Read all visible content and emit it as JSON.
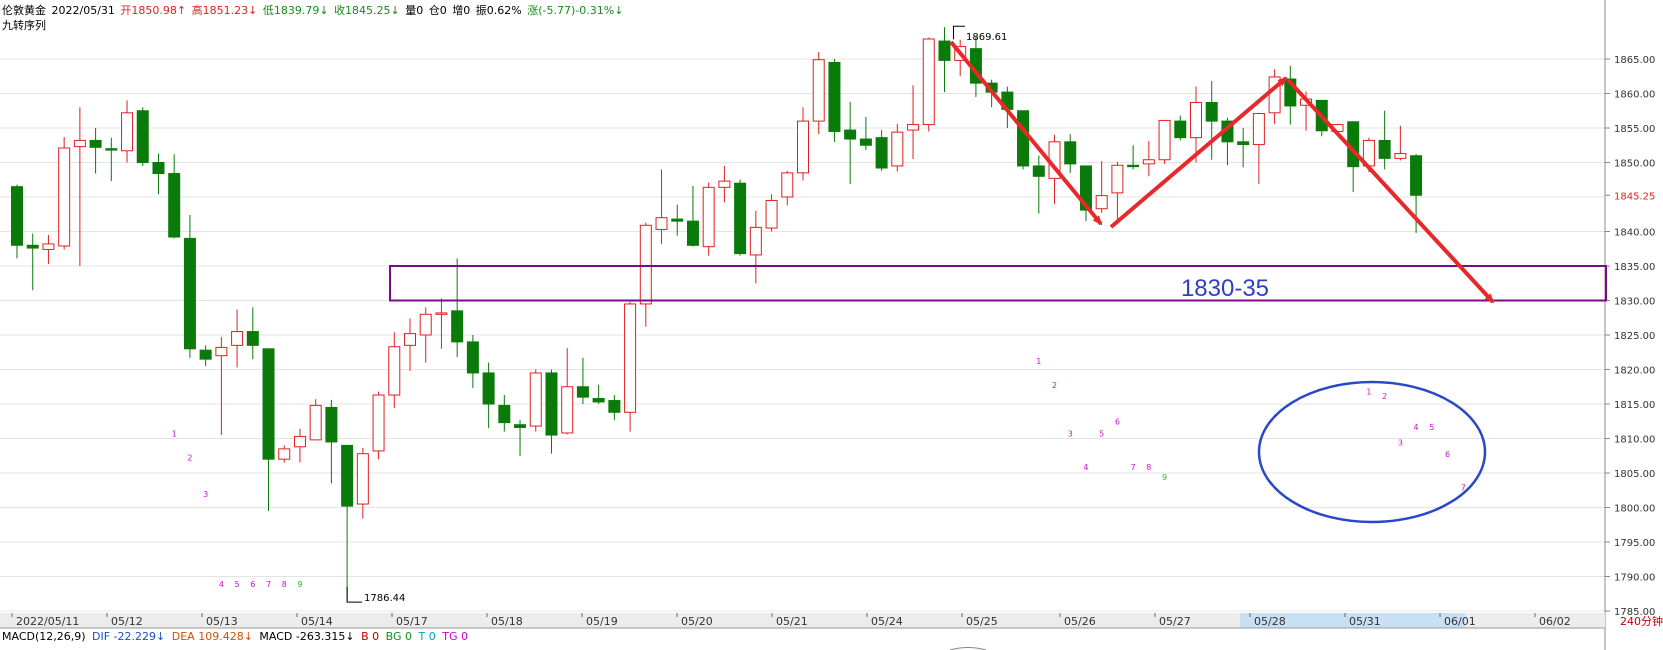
{
  "header": {
    "instrument": "伦敦黄金",
    "date": "2022/05/31",
    "open": "开1850.98↑",
    "high": "高1851.23↓",
    "low": "低1839.79↓",
    "close": "收1845.25↓",
    "volume": "量0",
    "position": "仓0",
    "increase": "增0",
    "amplitude": "振0.62%",
    "change": "涨(-5.77)-0.31%↓"
  },
  "indicator_name": "九转序列",
  "price_axis": {
    "labels": [
      "1865.00",
      "1860.00",
      "1855.00",
      "1850.00",
      "1845.25",
      "1840.00",
      "1835.00",
      "1830.00",
      "1825.00",
      "1820.00",
      "1815.00",
      "1810.00",
      "1805.00",
      "1800.00",
      "1795.00",
      "1790.00",
      "1785.00"
    ],
    "current_price": "1845.25",
    "current_color": "#e02020"
  },
  "date_axis": {
    "labels": [
      "2022/05/11",
      "05/12",
      "05/13",
      "05/14",
      "05/17",
      "05/18",
      "05/19",
      "05/20",
      "05/21",
      "05/24",
      "05/25",
      "05/26",
      "05/27",
      "05/28",
      "05/31",
      "06/01",
      "06/02"
    ],
    "period": "240分钟"
  },
  "annotations": {
    "high_label": "1869.61",
    "low_label": "1786.44",
    "zone_label": "1830-35"
  },
  "macd": {
    "name": "MACD(12,26,9)",
    "dif": "DIF -22.229↓",
    "dea": "DEA 109.428↓",
    "macd": "MACD -263.315↓",
    "b": "B 0",
    "bg": "BG 0",
    "t": "T 0",
    "tg": "TG 0"
  },
  "colors": {
    "up": "#e02020",
    "down": "#0a7a0a",
    "zone": "#7a0a8a",
    "circle": "#2848c8",
    "arrow": "#e8282a",
    "seq": "#d010d0",
    "seq9": "#20c020"
  },
  "chart_data": {
    "type": "candlestick",
    "y_axis_range": [
      1785,
      1865
    ],
    "candles": [
      {
        "o": 1846.5,
        "h": 1846.8,
        "l": 1836.1,
        "c": 1838.0
      },
      {
        "o": 1838.0,
        "h": 1839.7,
        "l": 1831.5,
        "c": 1837.6
      },
      {
        "o": 1837.4,
        "h": 1839.5,
        "l": 1835.3,
        "c": 1838.2
      },
      {
        "o": 1837.9,
        "h": 1853.7,
        "l": 1837.4,
        "c": 1852.1
      },
      {
        "o": 1852.3,
        "h": 1858.0,
        "l": 1835.0,
        "c": 1853.2
      },
      {
        "o": 1853.2,
        "h": 1855.0,
        "l": 1848.4,
        "c": 1852.2
      },
      {
        "o": 1852.0,
        "h": 1853.6,
        "l": 1847.3,
        "c": 1851.8
      },
      {
        "o": 1851.7,
        "h": 1859.0,
        "l": 1850.0,
        "c": 1857.2
      },
      {
        "o": 1857.5,
        "h": 1858.0,
        "l": 1849.5,
        "c": 1850.0
      },
      {
        "o": 1850.0,
        "h": 1851.3,
        "l": 1845.4,
        "c": 1848.4
      },
      {
        "o": 1848.4,
        "h": 1851.2,
        "l": 1839.0,
        "c": 1839.2
      },
      {
        "o": 1839.0,
        "h": 1842.4,
        "l": 1821.7,
        "c": 1823.0
      },
      {
        "o": 1822.8,
        "h": 1823.5,
        "l": 1820.5,
        "c": 1821.5
      },
      {
        "o": 1822.0,
        "h": 1824.7,
        "l": 1810.5,
        "c": 1823.2
      },
      {
        "o": 1823.5,
        "h": 1828.7,
        "l": 1820.3,
        "c": 1825.5
      },
      {
        "o": 1825.5,
        "h": 1829.0,
        "l": 1821.5,
        "c": 1823.5
      },
      {
        "o": 1823.0,
        "h": 1823.0,
        "l": 1799.5,
        "c": 1807.0
      },
      {
        "o": 1807.0,
        "h": 1809.0,
        "l": 1806.5,
        "c": 1808.5
      },
      {
        "o": 1808.8,
        "h": 1811.4,
        "l": 1806.5,
        "c": 1810.3
      },
      {
        "o": 1809.8,
        "h": 1815.7,
        "l": 1809.8,
        "c": 1814.8
      },
      {
        "o": 1814.5,
        "h": 1815.6,
        "l": 1803.5,
        "c": 1809.5
      },
      {
        "o": 1809.0,
        "h": 1809.0,
        "l": 1786.44,
        "c": 1800.2
      },
      {
        "o": 1800.5,
        "h": 1808.6,
        "l": 1798.4,
        "c": 1807.8
      },
      {
        "o": 1808.2,
        "h": 1816.8,
        "l": 1807.0,
        "c": 1816.3
      },
      {
        "o": 1816.3,
        "h": 1825.4,
        "l": 1814.4,
        "c": 1823.3
      },
      {
        "o": 1823.5,
        "h": 1827.4,
        "l": 1819.8,
        "c": 1825.2
      },
      {
        "o": 1825.0,
        "h": 1829.0,
        "l": 1821.0,
        "c": 1828.0
      },
      {
        "o": 1828.0,
        "h": 1830.3,
        "l": 1823.0,
        "c": 1828.2
      },
      {
        "o": 1828.5,
        "h": 1836.1,
        "l": 1821.8,
        "c": 1824.0
      },
      {
        "o": 1824.0,
        "h": 1825.0,
        "l": 1817.3,
        "c": 1819.5
      },
      {
        "o": 1819.5,
        "h": 1821.0,
        "l": 1811.5,
        "c": 1815.0
      },
      {
        "o": 1814.8,
        "h": 1816.3,
        "l": 1811.0,
        "c": 1812.3
      },
      {
        "o": 1812.0,
        "h": 1812.7,
        "l": 1807.5,
        "c": 1811.6
      },
      {
        "o": 1811.8,
        "h": 1820.0,
        "l": 1811.0,
        "c": 1819.5
      },
      {
        "o": 1819.5,
        "h": 1820.0,
        "l": 1807.8,
        "c": 1810.5
      },
      {
        "o": 1810.8,
        "h": 1823.1,
        "l": 1810.6,
        "c": 1817.5
      },
      {
        "o": 1817.5,
        "h": 1821.7,
        "l": 1815.0,
        "c": 1816.0
      },
      {
        "o": 1815.8,
        "h": 1817.8,
        "l": 1815.0,
        "c": 1815.3
      },
      {
        "o": 1815.5,
        "h": 1816.3,
        "l": 1812.7,
        "c": 1813.8
      },
      {
        "o": 1813.8,
        "h": 1829.8,
        "l": 1811.0,
        "c": 1829.5
      },
      {
        "o": 1829.5,
        "h": 1841.3,
        "l": 1826.2,
        "c": 1840.9
      },
      {
        "o": 1840.3,
        "h": 1849.0,
        "l": 1838.2,
        "c": 1842.0
      },
      {
        "o": 1841.8,
        "h": 1843.9,
        "l": 1839.4,
        "c": 1841.5
      },
      {
        "o": 1841.5,
        "h": 1846.6,
        "l": 1837.8,
        "c": 1838.0
      },
      {
        "o": 1837.8,
        "h": 1847.1,
        "l": 1836.5,
        "c": 1846.4
      },
      {
        "o": 1846.4,
        "h": 1849.5,
        "l": 1844.2,
        "c": 1847.3
      },
      {
        "o": 1847.0,
        "h": 1847.5,
        "l": 1836.5,
        "c": 1836.8
      },
      {
        "o": 1836.6,
        "h": 1843.0,
        "l": 1832.5,
        "c": 1840.6
      },
      {
        "o": 1840.5,
        "h": 1845.4,
        "l": 1840.0,
        "c": 1844.5
      },
      {
        "o": 1845.0,
        "h": 1848.8,
        "l": 1843.8,
        "c": 1848.5
      },
      {
        "o": 1848.5,
        "h": 1858.0,
        "l": 1847.4,
        "c": 1856.0
      },
      {
        "o": 1856.0,
        "h": 1866.0,
        "l": 1854.1,
        "c": 1864.9
      },
      {
        "o": 1864.5,
        "h": 1865.0,
        "l": 1853.0,
        "c": 1854.5
      },
      {
        "o": 1854.7,
        "h": 1858.8,
        "l": 1846.9,
        "c": 1853.4
      },
      {
        "o": 1853.4,
        "h": 1856.6,
        "l": 1851.8,
        "c": 1852.5
      },
      {
        "o": 1853.6,
        "h": 1854.7,
        "l": 1848.8,
        "c": 1849.2
      },
      {
        "o": 1849.5,
        "h": 1855.6,
        "l": 1848.7,
        "c": 1854.4
      },
      {
        "o": 1854.7,
        "h": 1861.2,
        "l": 1850.5,
        "c": 1855.5
      },
      {
        "o": 1855.5,
        "h": 1868.1,
        "l": 1854.5,
        "c": 1867.9
      },
      {
        "o": 1867.6,
        "h": 1869.61,
        "l": 1860.2,
        "c": 1864.8
      },
      {
        "o": 1864.8,
        "h": 1867.8,
        "l": 1862.5,
        "c": 1866.8
      },
      {
        "o": 1866.5,
        "h": 1868.3,
        "l": 1859.5,
        "c": 1861.5
      },
      {
        "o": 1861.5,
        "h": 1862.0,
        "l": 1858.0,
        "c": 1860.2
      },
      {
        "o": 1860.2,
        "h": 1861.0,
        "l": 1855.0,
        "c": 1857.7
      },
      {
        "o": 1857.5,
        "h": 1857.5,
        "l": 1849.0,
        "c": 1849.5
      },
      {
        "o": 1849.5,
        "h": 1851.0,
        "l": 1842.6,
        "c": 1848.0
      },
      {
        "o": 1847.7,
        "h": 1854.0,
        "l": 1844.0,
        "c": 1853.0
      },
      {
        "o": 1853.0,
        "h": 1854.1,
        "l": 1848.5,
        "c": 1849.8
      },
      {
        "o": 1849.5,
        "h": 1849.5,
        "l": 1841.5,
        "c": 1843.1
      },
      {
        "o": 1843.3,
        "h": 1850.2,
        "l": 1842.7,
        "c": 1845.2
      },
      {
        "o": 1845.6,
        "h": 1850.1,
        "l": 1841.2,
        "c": 1849.6
      },
      {
        "o": 1849.6,
        "h": 1852.5,
        "l": 1849.0,
        "c": 1849.4
      },
      {
        "o": 1849.8,
        "h": 1853.1,
        "l": 1848.0,
        "c": 1850.4
      },
      {
        "o": 1850.4,
        "h": 1856.1,
        "l": 1849.8,
        "c": 1856.1
      },
      {
        "o": 1856.0,
        "h": 1856.8,
        "l": 1853.2,
        "c": 1853.6
      },
      {
        "o": 1853.6,
        "h": 1861.0,
        "l": 1850.0,
        "c": 1858.7
      },
      {
        "o": 1858.7,
        "h": 1861.8,
        "l": 1850.4,
        "c": 1856.0
      },
      {
        "o": 1856.0,
        "h": 1856.5,
        "l": 1849.6,
        "c": 1853.0
      },
      {
        "o": 1853.0,
        "h": 1855.0,
        "l": 1849.3,
        "c": 1852.6
      },
      {
        "o": 1852.6,
        "h": 1857.2,
        "l": 1846.9,
        "c": 1857.1
      },
      {
        "o": 1857.2,
        "h": 1863.5,
        "l": 1855.6,
        "c": 1862.4
      },
      {
        "o": 1862.1,
        "h": 1864.0,
        "l": 1855.5,
        "c": 1858.2
      },
      {
        "o": 1858.3,
        "h": 1860.3,
        "l": 1854.6,
        "c": 1859.2
      },
      {
        "o": 1859.0,
        "h": 1859.0,
        "l": 1853.8,
        "c": 1854.6
      },
      {
        "o": 1854.5,
        "h": 1855.6,
        "l": 1854.0,
        "c": 1855.5
      },
      {
        "o": 1855.9,
        "h": 1856.0,
        "l": 1845.7,
        "c": 1849.4
      },
      {
        "o": 1849.5,
        "h": 1853.6,
        "l": 1848.6,
        "c": 1853.2
      },
      {
        "o": 1853.2,
        "h": 1857.5,
        "l": 1849.0,
        "c": 1850.6
      },
      {
        "o": 1850.6,
        "h": 1855.3,
        "l": 1850.3,
        "c": 1851.3
      },
      {
        "o": 1850.98,
        "h": 1851.23,
        "l": 1839.79,
        "c": 1845.25
      }
    ],
    "td_sequential": [
      {
        "i": 10,
        "n": "1",
        "y": 1810.3
      },
      {
        "i": 11,
        "n": "2",
        "y": 1806.8
      },
      {
        "i": 12,
        "n": "3",
        "y": 1801.5
      },
      {
        "i": 13,
        "n": "4",
        "y": 1788.5
      },
      {
        "i": 14,
        "n": "5",
        "y": 1788.5
      },
      {
        "i": 15,
        "n": "6",
        "y": 1788.5
      },
      {
        "i": 16,
        "n": "7",
        "y": 1788.5
      },
      {
        "i": 17,
        "n": "8",
        "y": 1788.5
      },
      {
        "i": 18,
        "n": "9",
        "y": 1788.5
      },
      {
        "i": 65,
        "n": "1",
        "y": 1820.8
      },
      {
        "i": 66,
        "n": "2",
        "y": 1817.3
      },
      {
        "i": 67,
        "n": "3",
        "y": 1810.3
      },
      {
        "i": 68,
        "n": "4",
        "y": 1805.4
      },
      {
        "i": 69,
        "n": "5",
        "y": 1810.3
      },
      {
        "i": 70,
        "n": "6",
        "y": 1812.0
      },
      {
        "i": 71,
        "n": "7",
        "y": 1805.4
      },
      {
        "i": 72,
        "n": "8",
        "y": 1805.4
      },
      {
        "i": 73,
        "n": "9",
        "y": 1804.0
      },
      {
        "i": 86,
        "n": "1",
        "y": 1816.4
      },
      {
        "i": 87,
        "n": "2",
        "y": 1815.7
      },
      {
        "i": 88,
        "n": "3",
        "y": 1809.0
      },
      {
        "i": 89,
        "n": "4",
        "y": 1811.2
      },
      {
        "i": 90,
        "n": "5",
        "y": 1811.2
      },
      {
        "i": 91,
        "n": "6",
        "y": 1807.3
      },
      {
        "i": 92,
        "n": "7",
        "y": 1802.5
      }
    ],
    "zone": {
      "from": 1830,
      "to": 1835,
      "label": "1830-35"
    }
  }
}
